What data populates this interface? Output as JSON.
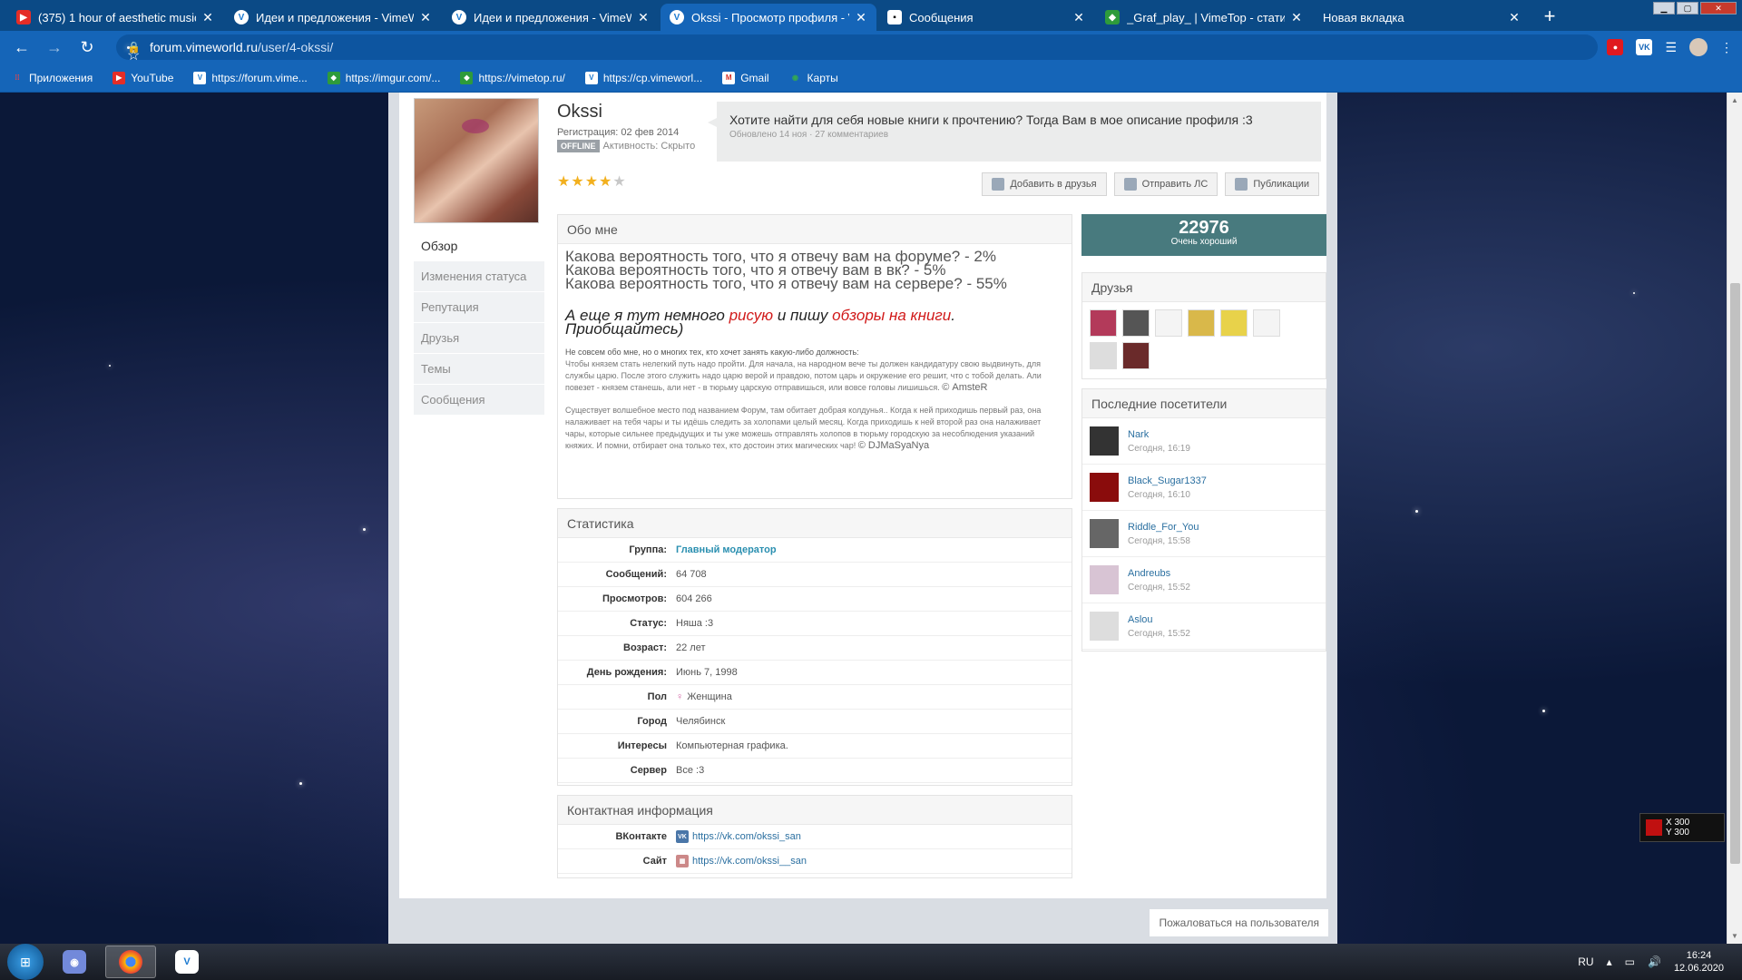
{
  "tabs": [
    {
      "icon": "youtube-icon",
      "title": "(375) 1 hour of aesthetic music -"
    },
    {
      "icon": "vimeworld-icon",
      "title": "Идеи и предложения - VimeWo"
    },
    {
      "icon": "vimeworld-icon",
      "title": "Идеи и предложения - VimeWo"
    },
    {
      "icon": "vimeworld-icon",
      "title": "Okssi - Просмотр профиля - Vi"
    },
    {
      "icon": "message-icon",
      "title": "Сообщения"
    },
    {
      "icon": "vimetop-icon",
      "title": "_Graf_play_ | VimeTop - статисти"
    },
    {
      "icon": "",
      "title": "Новая вкладка"
    }
  ],
  "address": {
    "host": "forum.vimeworld.ru",
    "path": "/user/4-okssi/"
  },
  "bookmarks": [
    {
      "icon": "apps-grid-icon",
      "label": "Приложения"
    },
    {
      "icon": "youtube-icon",
      "label": "YouTube"
    },
    {
      "icon": "vimeworld-icon",
      "label": "https://forum.vime..."
    },
    {
      "icon": "imgur-icon",
      "label": "https://imgur.com/..."
    },
    {
      "icon": "vimetop-icon",
      "label": "https://vimetop.ru/"
    },
    {
      "icon": "vimeworld-icon",
      "label": "https://cp.vimeworl..."
    },
    {
      "icon": "gmail-icon",
      "label": "Gmail"
    },
    {
      "icon": "maps-icon",
      "label": "Карты"
    }
  ],
  "profile": {
    "username": "Okssi",
    "registration": "Регистрация: 02 фев 2014",
    "offline_badge": "OFFLINE",
    "activity": "Активность: Скрыто",
    "rating_stars": 4,
    "rating_max": 5,
    "status_text": "Хотите найти для себя новые книги к прочтению? Тогда Вам в мое описание профиля :3",
    "status_meta": "Обновлено 14 ноя · 27 комментариев",
    "buttons": {
      "add_friend": "Добавить в друзья",
      "send_pm": "Отправить ЛС",
      "publications": "Публикации"
    }
  },
  "sidenav": [
    "Обзор",
    "Изменения статуса",
    "Репутация",
    "Друзья",
    "Темы",
    "Сообщения"
  ],
  "about": {
    "title": "Обо мне",
    "lines": [
      "Какова вероятность того, что я отвечу вам на форуме? - 2%",
      "Какова вероятность того, что я отвечу вам в вк? - 5%",
      "Какова вероятность того, что я отвечу вам на сервере? - 55%"
    ],
    "italic_part1": "А еще я тут немного ",
    "italic_red1": "рисую",
    "italic_part2": " и пишу ",
    "italic_red2": "обзоры на книги",
    "italic_part3": ". Приобщайтесь)",
    "quote1_head": "Не совсем обо мне, но о многих тех, кто хочет занять какую-либо должность:",
    "quote1": "Чтобы князем стать нелегкий путь надо пройти. Для начала, на народном вече ты должен кандидатуру свою выдвинуть, для службы царю. После этого служить надо царю верой и правдою, потом царь и окружение его решит, что с тобой делать. Али повезет - князем станешь, али нет - в тюрьму царскую отправишься, или вовсе головы лишишься.",
    "quote1_sign": "© AmsteR",
    "quote2": "Существует волшебное место под названием Форум, там обитает добрая колдунья.. Когда к ней приходишь первый раз, она налаживает на тебя чары и ты идёшь следить за холопами целый месяц. Когда приходишь к ней второй раз она налаживает чары, которые сильнее предыдущих и ты уже можешь отправлять холопов в тюрьму городскую за несоблюдения указаний княжих. И помни, отбирает она только тех, кто достоин этих магических чар!",
    "quote2_sign": "© DJMaSyaNya"
  },
  "stats": {
    "title": "Статистика",
    "rows": [
      {
        "label": "Группа:",
        "value": "Главный модератор"
      },
      {
        "label": "Сообщений:",
        "value": "64 708"
      },
      {
        "label": "Просмотров:",
        "value": "604 266"
      },
      {
        "label": "Статус:",
        "value": "Няша :3"
      },
      {
        "label": "Возраст:",
        "value": "22 лет"
      },
      {
        "label": "День рождения:",
        "value": "Июнь 7, 1998"
      },
      {
        "label": "Пол",
        "value": "Женщина"
      },
      {
        "label": "Город",
        "value": "Челябинск"
      },
      {
        "label": "Интересы",
        "value": "Компьютерная графика."
      },
      {
        "label": "Сервер",
        "value": "Все :3"
      }
    ]
  },
  "contact": {
    "title": "Контактная информация",
    "rows": [
      {
        "label": "ВКонтакте",
        "value": "https://vk.com/okssi_san"
      },
      {
        "label": "Сайт",
        "value": "https://vk.com/okssi__san"
      }
    ]
  },
  "reputation": {
    "value": "22976",
    "label": "Очень хороший",
    "color": "#487a7e"
  },
  "friends": {
    "title": "Друзья",
    "count": 8
  },
  "visitors": {
    "title": "Последние посетители",
    "items": [
      {
        "name": "Nark",
        "time": "Сегодня, 16:19"
      },
      {
        "name": "Black_Sugar1337",
        "time": "Сегодня, 16:10"
      },
      {
        "name": "Riddle_For_You",
        "time": "Сегодня, 15:58"
      },
      {
        "name": "Andreubs",
        "time": "Сегодня, 15:52"
      },
      {
        "name": "Aslou",
        "time": "Сегодня, 15:52"
      }
    ]
  },
  "report_button": "Пожаловаться на пользователя",
  "overlay": {
    "x": "X 300",
    "y": "Y 300"
  },
  "taskbar": {
    "lang": "RU",
    "time": "16:24",
    "date": "12.06.2020"
  }
}
